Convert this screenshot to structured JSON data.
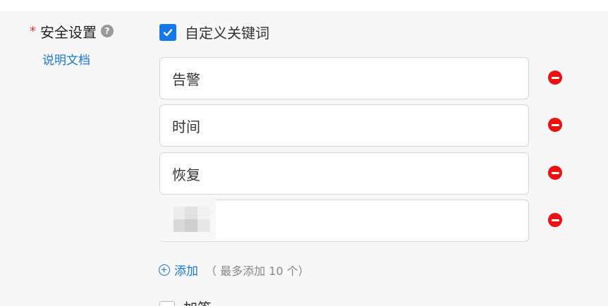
{
  "security": {
    "required_mark": "*",
    "label": "安全设置",
    "help_icon": "question-circle-icon",
    "doc_link": "说明文档"
  },
  "custom_keywords": {
    "checked": true,
    "label": "自定义关键词",
    "keywords": [
      "告警",
      "时间",
      "恢复",
      ""
    ],
    "remove_icon": "minus-circle-icon",
    "add_label": "添加",
    "add_hint": "（ 最多添加 10 个）"
  },
  "next_option": {
    "checked": false,
    "label": "加签"
  },
  "colors": {
    "accent": "#1677e5",
    "link": "#1a78d8",
    "remove": "#ee1111",
    "required": "#e63939"
  }
}
